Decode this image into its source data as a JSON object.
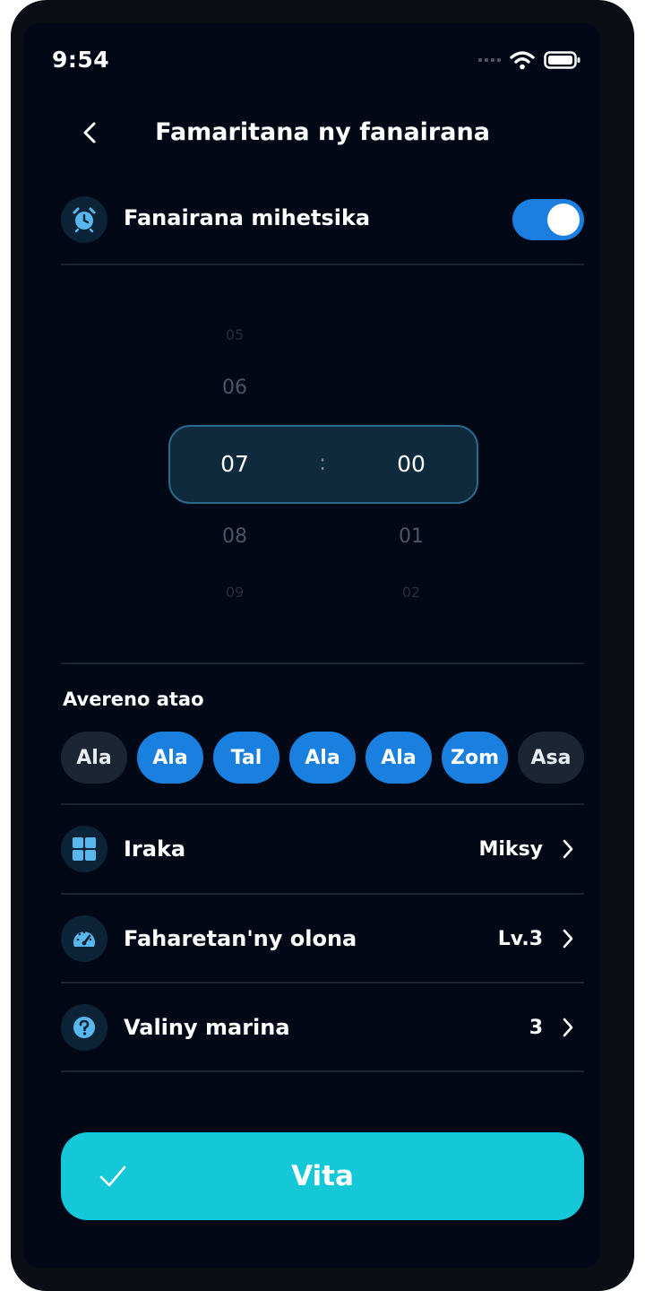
{
  "status_bar": {
    "time": "9:54"
  },
  "header": {
    "title": "Famaritana ny fanairana"
  },
  "smart_alarm": {
    "label": "Fanairana mihetsika",
    "enabled": true
  },
  "time_picker": {
    "hours": {
      "far_above": "05",
      "above": "06",
      "selected": "07",
      "below": "08",
      "far_below": "09"
    },
    "separator": ":",
    "minutes": {
      "selected": "00",
      "below": "01",
      "far_below": "02"
    }
  },
  "repeat": {
    "label": "Avereno atao",
    "days": [
      {
        "label": "Ala",
        "selected": false
      },
      {
        "label": "Ala",
        "selected": true
      },
      {
        "label": "Tal",
        "selected": true
      },
      {
        "label": "Ala",
        "selected": true
      },
      {
        "label": "Ala",
        "selected": true
      },
      {
        "label": "Zom",
        "selected": true
      },
      {
        "label": "Asa",
        "selected": false
      }
    ]
  },
  "settings": [
    {
      "label": "Iraka",
      "value": "Miksy",
      "icon": "grid-icon"
    },
    {
      "label": "Faharetan'ny olona",
      "value": "Lv.3",
      "icon": "gauge-icon"
    },
    {
      "label": "Valiny marina",
      "value": "3",
      "icon": "question-icon"
    }
  ],
  "confirm": {
    "label": "Vita",
    "icon": "check-icon"
  },
  "colors": {
    "background": "#020816",
    "accent_blue": "#1a80e0",
    "confirm_teal": "#14c8d8",
    "icon_blue": "#58b8ee"
  }
}
